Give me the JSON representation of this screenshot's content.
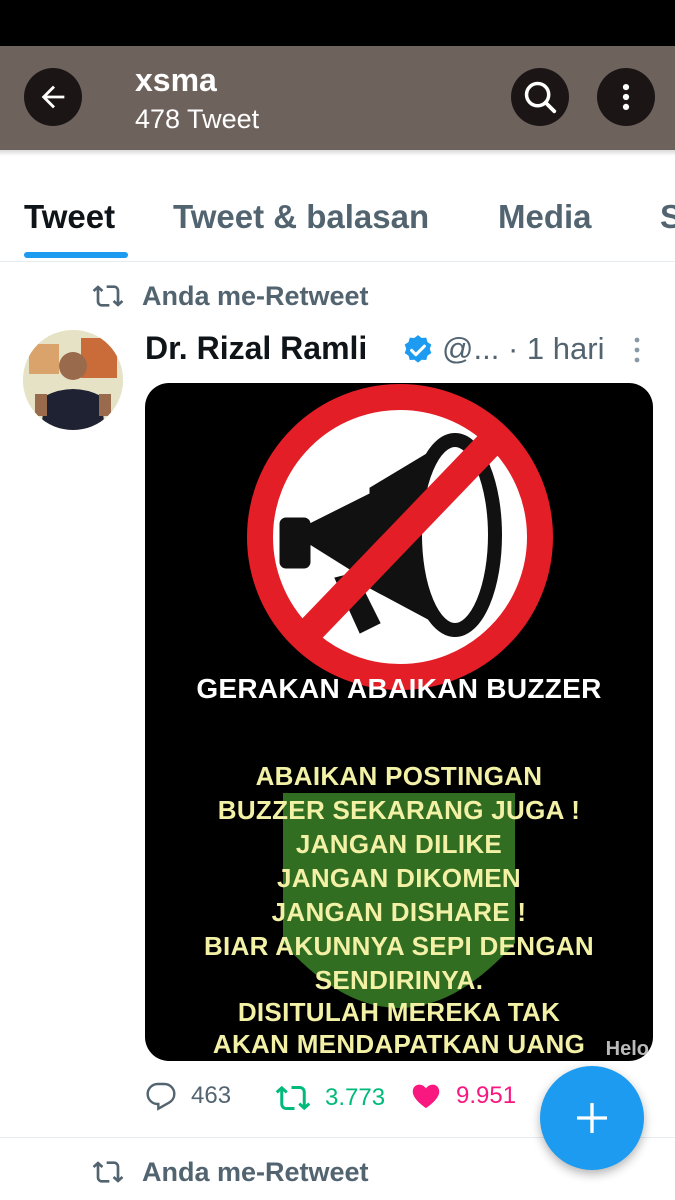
{
  "header": {
    "title": "xsma",
    "subtitle": "478 Tweet"
  },
  "tabs": [
    {
      "label": "Tweet",
      "active": true
    },
    {
      "label": "Tweet & balasan",
      "active": false
    },
    {
      "label": "Media",
      "active": false
    },
    {
      "label": "S",
      "active": false
    }
  ],
  "retweet_label": "Anda me-Retweet",
  "tweet": {
    "name": "Dr. Rizal Ramli",
    "handle": "@...",
    "time": "· 1 hari",
    "media": {
      "arc_text": "GERAKAN ABAIKAN BUZZER",
      "lines": [
        "ABAIKAN POSTINGAN",
        "BUZZER SEKARANG JUGA !",
        "JANGAN DILIKE",
        "JANGAN DIKOMEN",
        "JANGAN DISHARE !",
        "BIAR AKUNNYA SEPI DENGAN",
        "SENDIRINYA.",
        "DISITULAH MEREKA TAK",
        "AKAN MENDAPATKAN UANG"
      ],
      "watermark": "Helo"
    },
    "stats": {
      "replies": "463",
      "retweets": "3.773",
      "likes": "9.951"
    }
  },
  "colors": {
    "accent": "#1d9bf0",
    "retweet": "#00ba7c",
    "like": "#f91880",
    "header_bg": "#6e625d"
  },
  "next_retweet_label": "Anda me-Retweet"
}
